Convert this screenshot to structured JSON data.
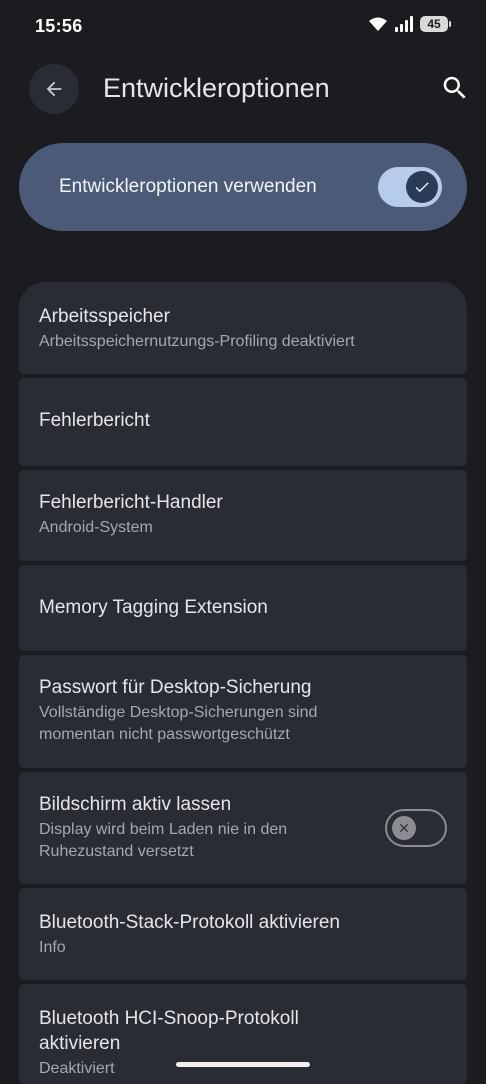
{
  "status_bar": {
    "time": "15:56",
    "battery": "45"
  },
  "header": {
    "title": "Entwickleroptionen",
    "back_icon": "arrow-back-icon",
    "search_icon": "search-icon"
  },
  "master_toggle": {
    "label": "Entwickleroptionen verwenden",
    "state": "on"
  },
  "items": [
    {
      "title": "Arbeitsspeicher",
      "subtitle": "Arbeitsspeichernutzungs-Profiling deaktiviert"
    },
    {
      "title": "Fehlerbericht"
    },
    {
      "title": "Fehlerbericht-Handler",
      "subtitle": "Android-System"
    },
    {
      "title": "Memory Tagging Extension"
    },
    {
      "title": "Passwort für Desktop-Sicherung",
      "subtitle_lines": [
        "Vollständige Desktop-Sicherungen sind",
        "momentan nicht passwortgeschützt"
      ]
    },
    {
      "title": "Bildschirm aktiv lassen",
      "subtitle_lines": [
        "Display wird beim Laden nie in den",
        "Ruhezustand versetzt"
      ],
      "toggle": "off"
    },
    {
      "title": "Bluetooth-Stack-Protokoll aktivieren",
      "subtitle": "Info"
    },
    {
      "title_lines": [
        "Bluetooth HCI-Snoop-Protokoll",
        "aktivieren"
      ],
      "subtitle": "Deaktiviert"
    }
  ],
  "colors": {
    "background": "#1b1c20",
    "card": "#2a2c33",
    "accent": "#4a5a77",
    "switch_on": "#b7cbeb"
  }
}
